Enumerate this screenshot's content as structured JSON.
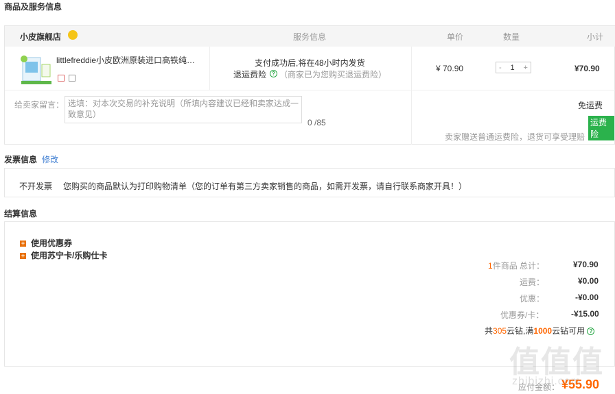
{
  "sections": {
    "goods_title": "商品及服务信息",
    "invoice_title": "发票信息",
    "invoice_edit": "修改",
    "settle_title": "结算信息"
  },
  "table_header": {
    "shop_name": "小皮旗舰店",
    "service": "服务信息",
    "unit_price": "单价",
    "quantity": "数量",
    "subtotal": "小计"
  },
  "product": {
    "name": "littlefreddie小皮欧洲原装进口高铁纯…",
    "service_line1": "支付成功后,将在48小时内发货",
    "service_line2_label": "退运费险",
    "service_line2_note": "（商家已为您购买退运费险）",
    "unit_price": "¥ 70.90",
    "qty_minus": "-",
    "qty_value": "1",
    "qty_plus": "+",
    "subtotal": "¥70.90"
  },
  "message": {
    "label": "给卖家留言：",
    "placeholder": "选填：对本次交易的补充说明（所填内容建议已经和卖家达成一致意见）",
    "counter": "0 /85",
    "shipping": "免运费",
    "insurance_tag": "运费险",
    "insurance_note": "卖家赠送普通运费险，退货可享受理赔"
  },
  "invoice": {
    "type": "不开发票",
    "note": "您购买的商品默认为打印购物清单（您的订单有第三方卖家销售的商品，如需开发票，请自行联系商家开具！）"
  },
  "settle": {
    "coupon": "使用优惠券",
    "card": "使用苏宁卡/乐购仕卡",
    "item_count": "1",
    "items_label": "件商品 总计：",
    "total": "¥70.90",
    "shipping_label": "运费：",
    "shipping": "¥0.00",
    "discount_label": "优惠：",
    "discount": "-¥0.00",
    "coupon_label": "优惠券/卡：",
    "coupon_value": "-¥15.00",
    "cloud_prefix": "共",
    "cloud_count": "305",
    "cloud_mid": "云钻,满",
    "cloud_threshold": "1000",
    "cloud_suffix": "云钻可用",
    "pay_label": "应付金额：",
    "pay_amount": "¥55.90"
  },
  "watermark": {
    "logo": "值值值",
    "site": "zhibizhi.com"
  },
  "colors": {
    "accent_orange": "#ff6600",
    "link_blue": "#3c7cd1",
    "green": "#2bb24c"
  }
}
